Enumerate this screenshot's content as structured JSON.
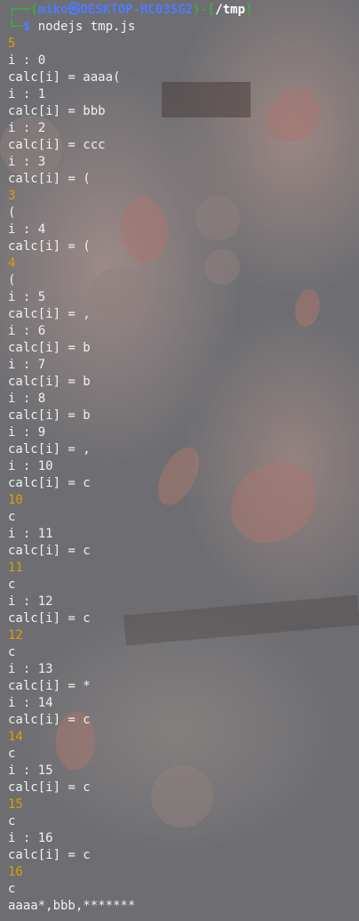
{
  "prompt": {
    "user_host": "miko㉿DESKTOP-HC03SG2",
    "path": "/tmp",
    "dollar": "$",
    "command": "nodejs tmp.js"
  },
  "output": [
    {
      "text": "5",
      "kind": "num"
    },
    {
      "text": "i : 0",
      "kind": "text"
    },
    {
      "text": "calc[i] = aaaa(",
      "kind": "text"
    },
    {
      "text": "i : 1",
      "kind": "text"
    },
    {
      "text": "calc[i] = bbb",
      "kind": "text"
    },
    {
      "text": "i : 2",
      "kind": "text"
    },
    {
      "text": "calc[i] = ccc",
      "kind": "text"
    },
    {
      "text": "i : 3",
      "kind": "text"
    },
    {
      "text": "calc[i] = (",
      "kind": "text"
    },
    {
      "text": "3",
      "kind": "num"
    },
    {
      "text": "(",
      "kind": "text"
    },
    {
      "text": "i : 4",
      "kind": "text"
    },
    {
      "text": "calc[i] = (",
      "kind": "text"
    },
    {
      "text": "4",
      "kind": "num"
    },
    {
      "text": "(",
      "kind": "text"
    },
    {
      "text": "i : 5",
      "kind": "text"
    },
    {
      "text": "calc[i] = ,",
      "kind": "text"
    },
    {
      "text": "i : 6",
      "kind": "text"
    },
    {
      "text": "calc[i] = b",
      "kind": "text"
    },
    {
      "text": "i : 7",
      "kind": "text"
    },
    {
      "text": "calc[i] = b",
      "kind": "text"
    },
    {
      "text": "i : 8",
      "kind": "text"
    },
    {
      "text": "calc[i] = b",
      "kind": "text"
    },
    {
      "text": "i : 9",
      "kind": "text"
    },
    {
      "text": "calc[i] = ,",
      "kind": "text"
    },
    {
      "text": "i : 10",
      "kind": "text"
    },
    {
      "text": "calc[i] = c",
      "kind": "text"
    },
    {
      "text": "10",
      "kind": "num"
    },
    {
      "text": "c",
      "kind": "text"
    },
    {
      "text": "i : 11",
      "kind": "text"
    },
    {
      "text": "calc[i] = c",
      "kind": "text"
    },
    {
      "text": "11",
      "kind": "num"
    },
    {
      "text": "c",
      "kind": "text"
    },
    {
      "text": "i : 12",
      "kind": "text"
    },
    {
      "text": "calc[i] = c",
      "kind": "text"
    },
    {
      "text": "12",
      "kind": "num"
    },
    {
      "text": "c",
      "kind": "text"
    },
    {
      "text": "i : 13",
      "kind": "text"
    },
    {
      "text": "calc[i] = *",
      "kind": "text"
    },
    {
      "text": "i : 14",
      "kind": "text"
    },
    {
      "text": "calc[i] = c",
      "kind": "text"
    },
    {
      "text": "14",
      "kind": "num"
    },
    {
      "text": "c",
      "kind": "text"
    },
    {
      "text": "i : 15",
      "kind": "text"
    },
    {
      "text": "calc[i] = c",
      "kind": "text"
    },
    {
      "text": "15",
      "kind": "num"
    },
    {
      "text": "c",
      "kind": "text"
    },
    {
      "text": "i : 16",
      "kind": "text"
    },
    {
      "text": "calc[i] = c",
      "kind": "text"
    },
    {
      "text": "16",
      "kind": "num"
    },
    {
      "text": "c",
      "kind": "text"
    },
    {
      "text": "aaaa*,bbb,*******",
      "kind": "text"
    }
  ],
  "colors": {
    "prompt_user": "#4b7cff",
    "prompt_bracket": "#29c42c",
    "number_output": "#d8a100",
    "text": "#f1f1f1"
  }
}
